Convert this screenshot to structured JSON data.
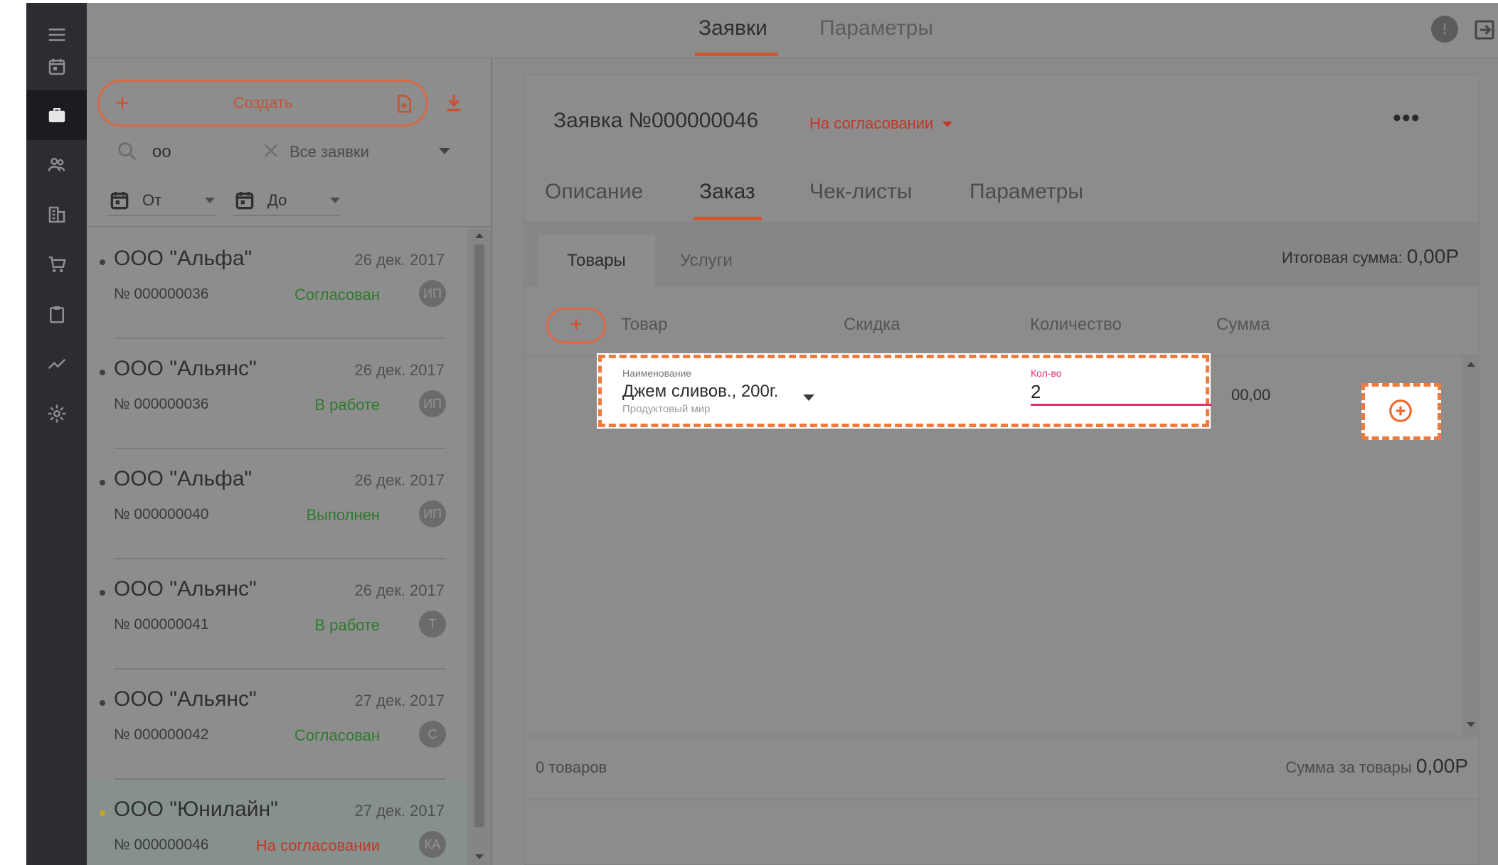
{
  "topbar": {
    "tabs": [
      {
        "label": "Заявки",
        "active": true
      },
      {
        "label": "Параметры",
        "active": false
      }
    ],
    "info_icon": "info-icon",
    "exit_icon": "exit-icon"
  },
  "sidebar": {
    "icons": [
      "menu-icon",
      "calendar-icon",
      "briefcase-icon",
      "users-icon",
      "building-icon",
      "cart-icon",
      "clipboard-icon",
      "chart-icon",
      "settings-icon"
    ],
    "active_index": 2
  },
  "list": {
    "create_label": "Создать",
    "search_value": "oo",
    "filter_value": "Все заявки",
    "date_from": "От",
    "date_to": "До",
    "orders": [
      {
        "name": "ООО \"Альфа\"",
        "date": "26 дек. 2017",
        "number": "№ 000000036",
        "status": "Согласован",
        "status_color": "#2f7a2f",
        "avatar": "ИП"
      },
      {
        "name": "ООО \"Альянс\"",
        "date": "26 дек. 2017",
        "number": "№ 000000036",
        "status": "В работе",
        "status_color": "#2f7a2f",
        "avatar": "ИП"
      },
      {
        "name": "ООО \"Альфа\"",
        "date": "26 дек. 2017",
        "number": "№ 000000040",
        "status": "Выполнен",
        "status_color": "#2f7a2f",
        "avatar": "ИП"
      },
      {
        "name": "ООО \"Альянс\"",
        "date": "26 дек. 2017",
        "number": "№ 000000041",
        "status": "В работе",
        "status_color": "#2f7a2f",
        "avatar": "Т"
      },
      {
        "name": "ООО \"Альянс\"",
        "date": "27 дек. 2017",
        "number": "№ 000000042",
        "status": "Согласован",
        "status_color": "#2f7a2f",
        "avatar": "С"
      },
      {
        "name": "ООО \"Юнилайн\"",
        "date": "27 дек. 2017",
        "number": "№ 000000046",
        "status": "На согласовании",
        "status_color": "#c0392b",
        "avatar": "КА"
      }
    ]
  },
  "detail": {
    "title": "Заявка №000000046",
    "status": "На согласовании",
    "more_label": "•••",
    "tabs": [
      "Описание",
      "Заказ",
      "Чек-листы",
      "Параметры"
    ],
    "active_tab": "Заказ",
    "subtabs": [
      "Товары",
      "Услуги"
    ],
    "total_label": "Итоговая сумма:",
    "total_value": "0,00Р",
    "columns": [
      "Товар",
      "Скидка",
      "Количество",
      "Сумма"
    ],
    "row_sum_partial": "00,00",
    "footer_count": "0 товаров",
    "footer_sum_label": "Сумма за товары",
    "footer_sum_value": "0,00Р"
  },
  "edit_row": {
    "name_label": "Наименование",
    "name_value": "Джем сливов., 200г.",
    "name_sub": "Продуктовый мир",
    "qty_label": "Кол-во",
    "qty_value": "2"
  },
  "colors": {
    "accent": "#d3552d",
    "highlight": "#ee7a3e",
    "field_focus": "#e3306a"
  }
}
